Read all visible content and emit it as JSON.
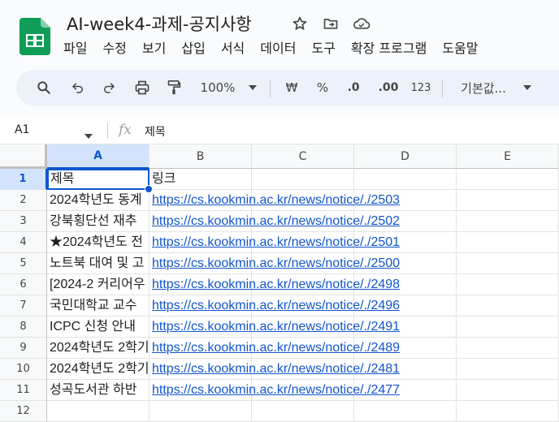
{
  "doc": {
    "title": "AI-week4-과제-공지사항"
  },
  "menu": [
    "파일",
    "수정",
    "보기",
    "삽입",
    "서식",
    "데이터",
    "도구",
    "확장 프로그램",
    "도움말"
  ],
  "toolbar": {
    "zoom": "100%",
    "currency": "₩",
    "percent": "%",
    "dec_less": ".0",
    "dec_more": ".00",
    "number_format": "123",
    "font": "기본값..."
  },
  "formula": {
    "cell_ref": "A1",
    "fx": "fx",
    "value": "제목"
  },
  "columns": [
    "A",
    "B",
    "C",
    "D",
    "E"
  ],
  "rows": [
    "1",
    "2",
    "3",
    "4",
    "5",
    "6",
    "7",
    "8",
    "9",
    "10",
    "11",
    "12"
  ],
  "cells": {
    "r1": {
      "a": "제목",
      "b": "링크"
    },
    "r2": {
      "a": "2024학년도 동계",
      "b": "https://cs.kookmin.ac.kr/news/notice/./2503"
    },
    "r3": {
      "a": "강북횡단선 재추",
      "b": "https://cs.kookmin.ac.kr/news/notice/./2502"
    },
    "r4": {
      "a": "★2024학년도 전",
      "b": "https://cs.kookmin.ac.kr/news/notice/./2501"
    },
    "r5": {
      "a": "노트북 대여 및 고",
      "b": "https://cs.kookmin.ac.kr/news/notice/./2500"
    },
    "r6": {
      "a": "[2024-2 커리어우",
      "b": "https://cs.kookmin.ac.kr/news/notice/./2498"
    },
    "r7": {
      "a": "국민대학교 교수",
      "b": "https://cs.kookmin.ac.kr/news/notice/./2496"
    },
    "r8": {
      "a": "ICPC 신청 안내",
      "b": "https://cs.kookmin.ac.kr/news/notice/./2491"
    },
    "r9": {
      "a": "2024학년도 2학기",
      "b": "https://cs.kookmin.ac.kr/news/notice/./2489"
    },
    "r10": {
      "a": "2024학년도 2학기",
      "b": "https://cs.kookmin.ac.kr/news/notice/./2481"
    },
    "r11": {
      "a": "성곡도서관 하반",
      "b": "https://cs.kookmin.ac.kr/news/notice/./2477"
    }
  },
  "colors": {
    "accent": "#0b57d0",
    "link": "#1155cc",
    "selected_header": "#d3e3fd",
    "sheets_green": "#0f9d58"
  }
}
